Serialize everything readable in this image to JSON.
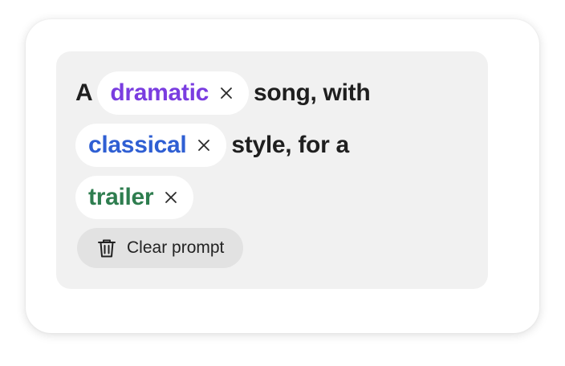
{
  "prompt": {
    "word_a": "A",
    "chip_style": {
      "label": "dramatic",
      "color": "#7a3de0"
    },
    "text_after_style": "song, with",
    "chip_genre": {
      "label": "classical",
      "color": "#2f5fd3"
    },
    "text_after_genre": "style, for a",
    "chip_use": {
      "label": "trailer",
      "color": "#2e7d4f"
    }
  },
  "actions": {
    "clear_label": "Clear prompt",
    "clear_icon": "trash-icon"
  },
  "remove_icon": "close-icon"
}
